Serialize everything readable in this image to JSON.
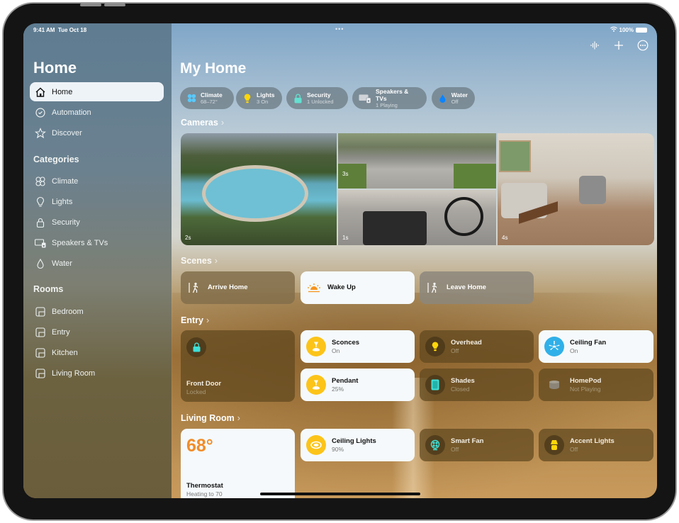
{
  "status_bar": {
    "time": "9:41 AM",
    "date": "Tue Oct 18",
    "battery": "100%",
    "dots": "•••"
  },
  "sidebar": {
    "title": "Home",
    "items": [
      {
        "label": "Home",
        "icon": "house-icon",
        "active": true
      },
      {
        "label": "Automation",
        "icon": "clock-check-icon"
      },
      {
        "label": "Discover",
        "icon": "star-icon"
      }
    ],
    "categories_heading": "Categories",
    "categories": [
      {
        "label": "Climate",
        "icon": "fan-icon"
      },
      {
        "label": "Lights",
        "icon": "lightbulb-icon"
      },
      {
        "label": "Security",
        "icon": "lock-icon"
      },
      {
        "label": "Speakers & TVs",
        "icon": "tv-speaker-icon"
      },
      {
        "label": "Water",
        "icon": "drop-icon"
      }
    ],
    "rooms_heading": "Rooms",
    "rooms": [
      {
        "label": "Bedroom",
        "icon": "room-icon"
      },
      {
        "label": "Entry",
        "icon": "room-icon"
      },
      {
        "label": "Kitchen",
        "icon": "room-icon"
      },
      {
        "label": "Living Room",
        "icon": "room-icon"
      }
    ]
  },
  "toolbar": {
    "voice_icon": "waveform-icon",
    "add_icon": "plus-icon",
    "more_icon": "ellipsis-circle-icon"
  },
  "main": {
    "title": "My Home",
    "chips": [
      {
        "label": "Climate",
        "status": "68–72°",
        "icon": "fan-icon",
        "color": "#5ac8fa"
      },
      {
        "label": "Lights",
        "status": "3 On",
        "icon": "lightbulb-icon",
        "color": "#ffd60a"
      },
      {
        "label": "Security",
        "status": "1 Unlocked",
        "icon": "lock-icon",
        "color": "#64e0d0"
      },
      {
        "label": "Speakers & TVs",
        "status": "1 Playing",
        "icon": "tv-speaker-icon",
        "color": "#d0d4d8"
      },
      {
        "label": "Water",
        "status": "Off",
        "icon": "drop-icon",
        "color": "#0a84ff"
      }
    ],
    "cameras_heading": "Cameras",
    "cameras": [
      {
        "label": "2s",
        "scene": "Backyard pool"
      },
      {
        "label": "3s",
        "scene": "Driveway"
      },
      {
        "label": "1s",
        "scene": "Garage"
      },
      {
        "label": "4s",
        "scene": "Living room"
      }
    ],
    "scenes_heading": "Scenes",
    "scenes": [
      {
        "label": "Arrive Home",
        "icon": "arrive-home-icon",
        "active": false
      },
      {
        "label": "Wake Up",
        "icon": "sunrise-icon",
        "active": true
      },
      {
        "label": "Leave Home",
        "icon": "leave-home-icon",
        "active": false
      }
    ],
    "entry_heading": "Entry",
    "entry": [
      {
        "name": "Front Door",
        "status": "Locked",
        "icon": "lock-icon",
        "on": false
      },
      {
        "name": "Sconces",
        "status": "On",
        "icon": "pendant-lamp-icon",
        "on": true
      },
      {
        "name": "Overhead",
        "status": "Off",
        "icon": "lightbulb-icon",
        "on": false
      },
      {
        "name": "Ceiling Fan",
        "status": "On",
        "icon": "ceiling-fan-icon",
        "on": true
      },
      {
        "name": "Pendant",
        "status": "25%",
        "icon": "pendant-lamp-icon",
        "on": true
      },
      {
        "name": "Shades",
        "status": "Closed",
        "icon": "shades-icon",
        "on": false
      },
      {
        "name": "HomePod",
        "status": "Not Playing",
        "icon": "homepod-icon",
        "on": false
      }
    ],
    "living_heading": "Living Room",
    "living": [
      {
        "name": "Thermostat",
        "status": "Heating to 70",
        "value": "68°",
        "icon": "thermostat-icon"
      },
      {
        "name": "Ceiling Lights",
        "status": "90%",
        "icon": "ceiling-light-icon",
        "on": true
      },
      {
        "name": "Smart Fan",
        "status": "Off",
        "icon": "fan-icon",
        "on": false
      },
      {
        "name": "Accent Lights",
        "status": "Off",
        "icon": "table-lamp-icon",
        "on": false
      }
    ]
  },
  "colors": {
    "accent_yellow": "#fcc419",
    "accent_blue": "#30b0e8",
    "thermostat_orange": "#f28c28",
    "lock_teal": "#3ee0d8"
  }
}
